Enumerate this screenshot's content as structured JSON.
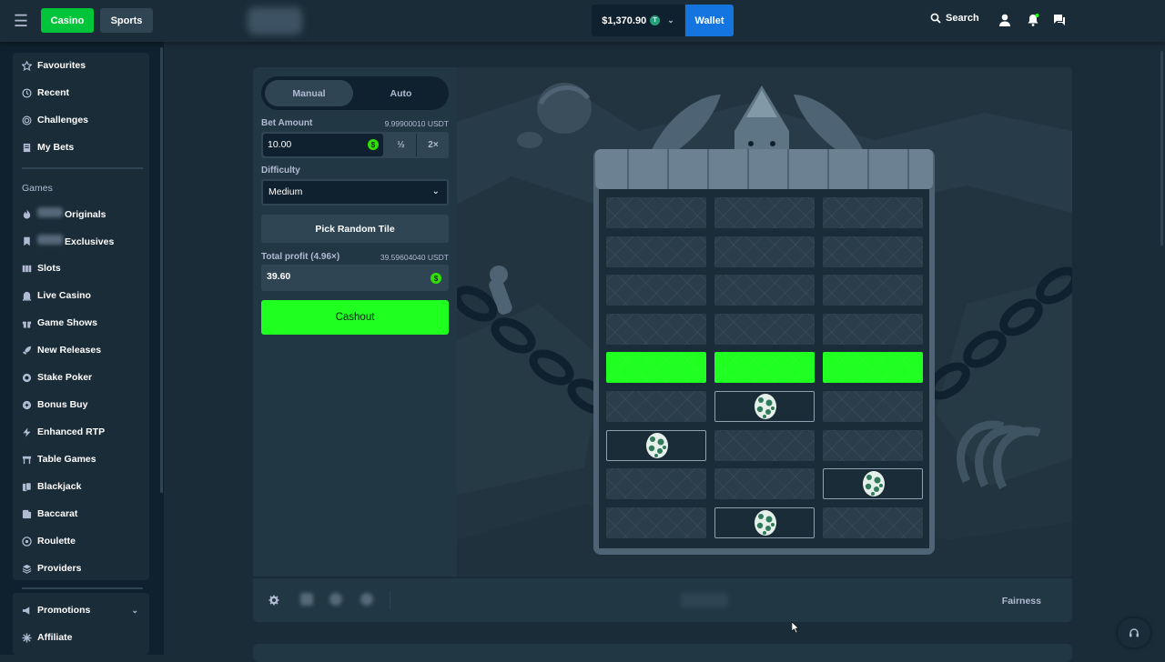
{
  "header": {
    "casino_label": "Casino",
    "sports_label": "Sports",
    "balance": "$1,370.90",
    "currency_badge": "T",
    "wallet_label": "Wallet",
    "search_label": "Search"
  },
  "sidebar": {
    "top_items": [
      {
        "label": "Favourites",
        "icon": "star-icon"
      },
      {
        "label": "Recent",
        "icon": "clock-icon"
      },
      {
        "label": "Challenges",
        "icon": "target-icon"
      },
      {
        "label": "My Bets",
        "icon": "receipt-icon"
      }
    ],
    "games_heading": "Games",
    "game_items": [
      {
        "label": "Originals",
        "icon": "flame-icon"
      },
      {
        "label": "Exclusives",
        "icon": "bookmark-icon"
      },
      {
        "label": "Slots",
        "icon": "slots-icon"
      },
      {
        "label": "Live Casino",
        "icon": "live-icon"
      },
      {
        "label": "Game Shows",
        "icon": "gift-icon"
      },
      {
        "label": "New Releases",
        "icon": "rocket-icon"
      },
      {
        "label": "Stake Poker",
        "icon": "chip-icon"
      },
      {
        "label": "Bonus Buy",
        "icon": "bonus-icon"
      },
      {
        "label": "Enhanced RTP",
        "icon": "bolt-icon"
      },
      {
        "label": "Table Games",
        "icon": "table-icon"
      },
      {
        "label": "Blackjack",
        "icon": "cards-icon"
      },
      {
        "label": "Baccarat",
        "icon": "baccarat-icon"
      },
      {
        "label": "Roulette",
        "icon": "roulette-icon"
      },
      {
        "label": "Providers",
        "icon": "layers-icon"
      }
    ],
    "promotions_label": "Promotions",
    "affiliate_label": "Affiliate"
  },
  "controls": {
    "mode_manual": "Manual",
    "mode_auto": "Auto",
    "bet_amount_label": "Bet Amount",
    "bet_amount_usdt": "9.99900010 USDT",
    "bet_value": "10.00",
    "half_label": "½",
    "double_label": "2×",
    "difficulty_label": "Difficulty",
    "difficulty_value": "Medium",
    "pick_random_label": "Pick Random Tile",
    "profit_label": "Total profit (4.96×)",
    "profit_usdt": "39.59604040 USDT",
    "profit_value": "39.60",
    "cashout_label": "Cashout"
  },
  "board": {
    "columns": 3,
    "rows_top_to_bottom": [
      [
        "hidden",
        "hidden",
        "hidden"
      ],
      [
        "hidden",
        "hidden",
        "hidden"
      ],
      [
        "hidden",
        "hidden",
        "hidden"
      ],
      [
        "hidden",
        "hidden",
        "hidden"
      ],
      [
        "win",
        "win",
        "win"
      ],
      [
        "hidden",
        "egg",
        "hidden"
      ],
      [
        "egg",
        "hidden",
        "hidden"
      ],
      [
        "hidden",
        "hidden",
        "egg"
      ],
      [
        "hidden",
        "egg",
        "hidden"
      ]
    ]
  },
  "footer": {
    "fairness_label": "Fairness"
  },
  "colors": {
    "accent_green": "#1fff20",
    "casino_green": "#00c53a",
    "wallet_blue": "#1475e1",
    "bg_dark": "#0f212e",
    "bg_panel": "#213743"
  }
}
